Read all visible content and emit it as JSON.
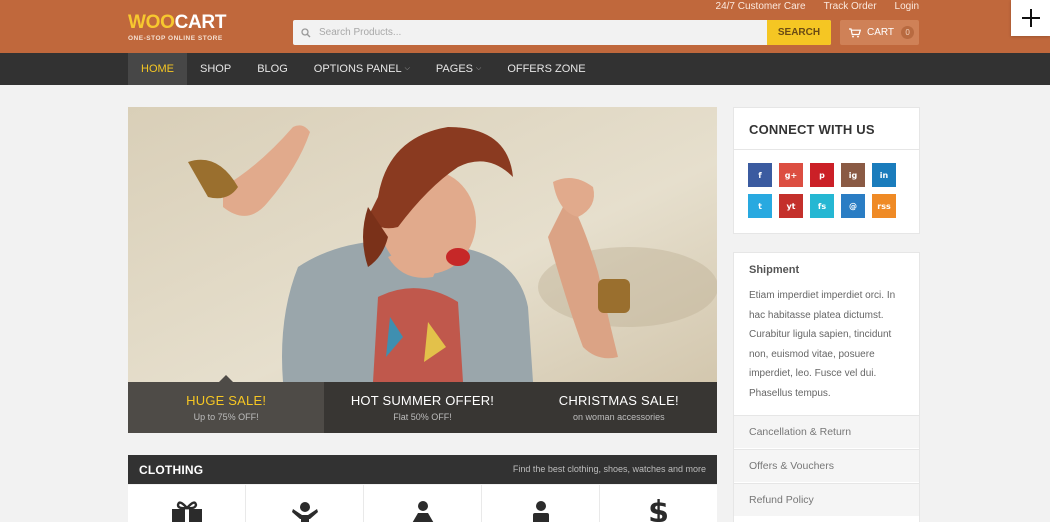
{
  "header": {
    "logo": {
      "part1": "WOO",
      "part2": "CART",
      "tagline": "ONE-STOP ONLINE STORE"
    },
    "top_links": [
      "24/7 Customer Care",
      "Track Order",
      "Login"
    ],
    "search": {
      "placeholder": "Search Products...",
      "button": "SEARCH",
      "icon": "search-icon"
    },
    "cart": {
      "label": "CART",
      "count": "0",
      "icon": "cart-icon"
    },
    "expand_icon": "plus-icon",
    "colors": {
      "header_bg": "#c0683c",
      "accent": "#f5c623"
    }
  },
  "nav": {
    "items": [
      {
        "label": "HOME",
        "active": true
      },
      {
        "label": "SHOP"
      },
      {
        "label": "BLOG"
      },
      {
        "label": "OPTIONS PANEL",
        "dropdown": true
      },
      {
        "label": "PAGES",
        "dropdown": true
      },
      {
        "label": "OFFERS ZONE"
      }
    ]
  },
  "slider": {
    "tabs": [
      {
        "title": "HUGE SALE!",
        "subtitle": "Up to 75% OFF!",
        "active": true
      },
      {
        "title": "HOT SUMMER OFFER!",
        "subtitle": "Flat 50% OFF!"
      },
      {
        "title": "CHRISTMAS SALE!",
        "subtitle": "on woman accessories"
      }
    ]
  },
  "clothing": {
    "title": "CLOTHING",
    "subtitle": "Find the best clothing, shoes, watches and more",
    "icons": [
      "gift-icon",
      "child-icon",
      "woman-icon",
      "man-icon",
      "dollar-icon"
    ]
  },
  "sidebar": {
    "connect": {
      "title": "CONNECT WITH US",
      "socials": [
        {
          "name": "facebook-icon",
          "glyph": "f",
          "color": "#3b5ba0"
        },
        {
          "name": "google-plus-icon",
          "glyph": "g+",
          "color": "#dc4e41"
        },
        {
          "name": "pinterest-icon",
          "glyph": "p",
          "color": "#cb2027"
        },
        {
          "name": "instagram-icon",
          "glyph": "ig",
          "color": "#8a5a44"
        },
        {
          "name": "linkedin-icon",
          "glyph": "in",
          "color": "#1a7cbc"
        },
        {
          "name": "twitter-icon",
          "glyph": "t",
          "color": "#28a9e0"
        },
        {
          "name": "youtube-icon",
          "glyph": "yt",
          "color": "#c4302b"
        },
        {
          "name": "foursquare-icon",
          "glyph": "fs",
          "color": "#25b7d3"
        },
        {
          "name": "email-icon",
          "glyph": "@",
          "color": "#2a7dc4"
        },
        {
          "name": "rss-icon",
          "glyph": "rss",
          "color": "#ef8a25"
        }
      ]
    },
    "shipment": {
      "title": "Shipment",
      "body": "Etiam imperdiet imperdiet orci. In hac habitasse platea dictumst. Curabitur ligula sapien, tincidunt non, euismod vitae, posuere imperdiet, leo. Fusce vel dui. Phasellus tempus."
    },
    "accordion": [
      "Cancellation & Return",
      "Offers & Vouchers",
      "Refund Policy"
    ]
  }
}
